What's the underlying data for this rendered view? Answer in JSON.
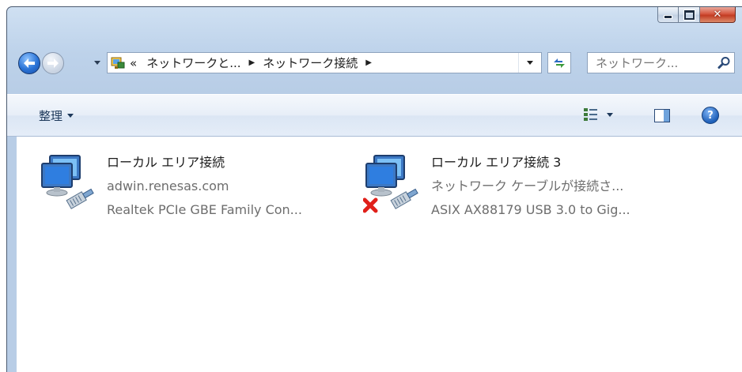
{
  "window": {
    "caption": {
      "minimize": "minimize",
      "maximize": "maximize",
      "close": "close"
    }
  },
  "nav": {
    "address": {
      "overflow": "«",
      "crumbs": [
        "ネットワークと...",
        "ネットワーク接続"
      ]
    },
    "search_placeholder": "ネットワーク..."
  },
  "toolbar": {
    "organize_label": "整理"
  },
  "connections": [
    {
      "name": "ローカル エリア接続",
      "status": "adwin.renesas.com",
      "device": "Realtek PCIe GBE Family Con...",
      "disconnected": false
    },
    {
      "name": "ローカル エリア接続 3",
      "status": "ネットワーク ケーブルが接続さ...",
      "device": "ASIX AX88179 USB 3.0 to Gig...",
      "disconnected": true
    }
  ],
  "colors": {
    "accent": "#2a73d6",
    "close_button": "#c23b22",
    "disconnected_x": "#e0201a"
  },
  "icons": [
    "back-arrow-icon",
    "forward-arrow-icon",
    "network-folder-icon",
    "refresh-icon",
    "search-icon",
    "views-icon",
    "preview-pane-icon",
    "help-icon",
    "network-adapter-icon",
    "disconnected-x-icon"
  ]
}
